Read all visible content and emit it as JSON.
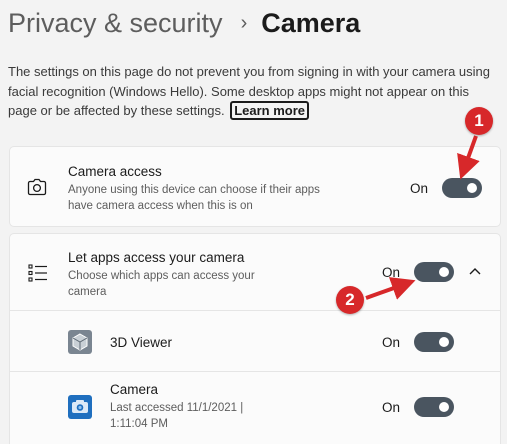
{
  "header": {
    "parent": "Privacy & security",
    "separator": "›",
    "current": "Camera"
  },
  "description": {
    "text": "The settings on this page do not prevent you from signing in with your camera using facial recognition (Windows Hello). Some desktop apps might not appear on this page or be affected by these settings.",
    "learn_more": "Learn more"
  },
  "camera_access": {
    "title": "Camera access",
    "subtitle": "Anyone using this device can choose if their apps have camera access when this is on",
    "state_label": "On",
    "icon": "camera-icon"
  },
  "let_apps": {
    "title": "Let apps access your camera",
    "subtitle": "Choose which apps can access your camera",
    "state_label": "On",
    "icon": "list-icon"
  },
  "apps": [
    {
      "name": "3D Viewer",
      "state_label": "On",
      "icon": "3d-viewer-icon"
    },
    {
      "name": "Camera",
      "detail": "Last accessed 11/1/2021 | 1:11:04 PM",
      "state_label": "On",
      "icon": "camera-app-icon"
    }
  ],
  "annotations": [
    {
      "number": "1",
      "color": "#d7282a"
    },
    {
      "number": "2",
      "color": "#d7282a"
    }
  ],
  "colors": {
    "toggle_on": "#4a5560",
    "background": "#f3f3f3",
    "card": "#fbfbfb"
  }
}
